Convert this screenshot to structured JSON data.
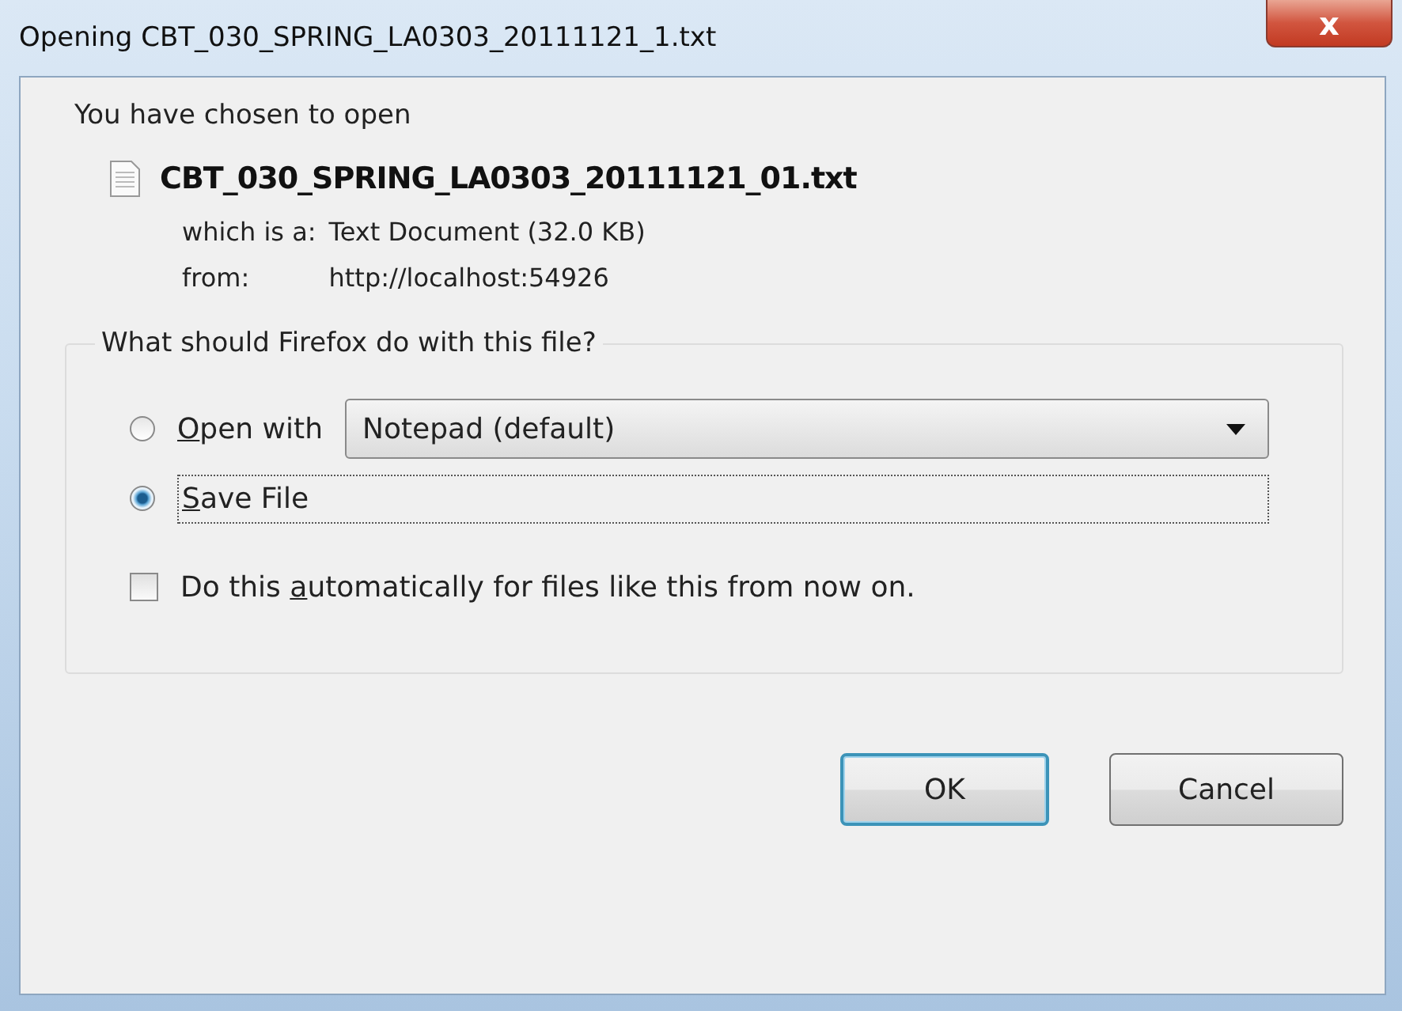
{
  "window": {
    "title": "Opening CBT_030_SPRING_LA0303_20111121_1.txt",
    "close": "x"
  },
  "intro": "You have chosen to open",
  "file": {
    "name": "CBT_030_SPRING_LA0303_20111121_01.txt",
    "type_label": "which is a:",
    "type_value": "Text Document (32.0  KB)",
    "from_label": "from:",
    "from_value": "http://localhost:54926"
  },
  "group": {
    "legend": "What should Firefox do with this file?",
    "options": [
      {
        "kind": "open",
        "label": {
          "key": "O",
          "after": "pen with"
        },
        "selected": false,
        "app": "Notepad (default)"
      },
      {
        "kind": "save",
        "label": {
          "key": "S",
          "after": "ave File"
        },
        "selected": true
      }
    ],
    "auto": {
      "label": {
        "before": "Do this ",
        "key": "a",
        "after": "utomatically for files like this from now on."
      },
      "checked": false
    }
  },
  "buttons": [
    {
      "label": "OK",
      "default": true
    },
    {
      "label": "Cancel",
      "default": false
    }
  ]
}
